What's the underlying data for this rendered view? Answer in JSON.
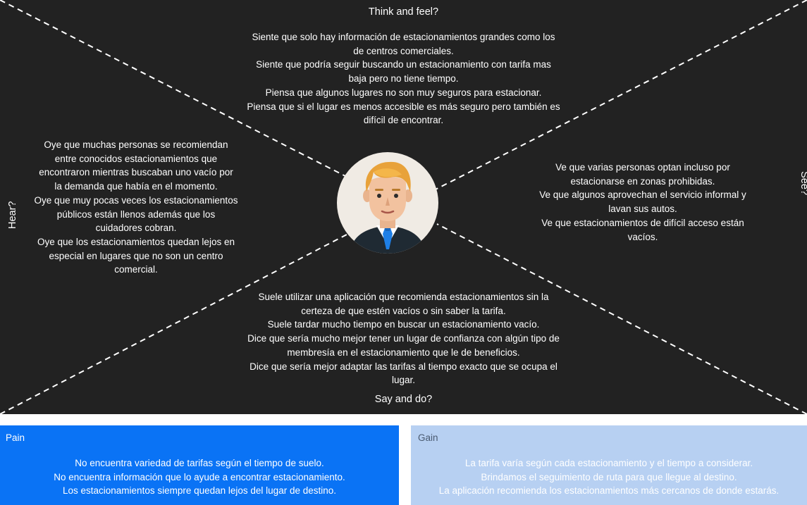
{
  "empathy_map": {
    "think_feel": {
      "title": "Think and feel?",
      "lines": [
        "Siente que solo hay información de estacionamientos grandes como los",
        "de centros comerciales.",
        "Siente que podría seguir buscando un estacionamiento con tarifa mas",
        "baja pero no tiene tiempo.",
        "Piensa que algunos lugares no son muy seguros para estacionar.",
        "Piensa que si el lugar es menos accesible es más seguro pero también es",
        "difícil de encontrar."
      ]
    },
    "hear": {
      "title": "Hear?",
      "lines": [
        "Oye que muchas personas se recomiendan",
        "entre conocidos estacionamientos que",
        "encontraron mientras buscaban uno vacío por",
        "la demanda que había en el momento.",
        "Oye que muy pocas veces los estacionamientos",
        "públicos están llenos además que los",
        "cuidadores cobran.",
        "Oye que los estacionamientos quedan lejos en",
        "especial en lugares que no son un centro",
        "comercial."
      ]
    },
    "see": {
      "title": "See?",
      "lines": [
        "Ve que varias personas optan incluso por",
        "estacionarse en zonas prohibidas.",
        "Ve que algunos aprovechan el servicio informal y",
        "lavan sus autos.",
        "Ve que estacionamientos de difícil acceso están",
        "vacíos."
      ]
    },
    "say_do": {
      "title": "Say and do?",
      "lines": [
        "Suele utilizar una aplicación que recomienda estacionamientos sin la",
        "certeza de que estén vacíos o sin saber la tarifa.",
        "Suele tardar mucho tiempo en buscar un estacionamiento vacío.",
        "Dice que sería  mucho mejor tener un lugar de confianza con algún tipo de",
        "membresía en el estacionamiento que le de beneficios.",
        "Dice que sería mejor adaptar las tarifas al tiempo exacto que se ocupa el",
        "lugar."
      ]
    },
    "center_icon": "user-avatar-icon"
  },
  "pain": {
    "label": "Pain",
    "lines": [
      "No encuentra variedad de tarifas según el tiempo de suelo.",
      "No encuentra información que lo ayude a encontrar estacionamiento.",
      "Los estacionamientos siempre quedan lejos del lugar de destino."
    ]
  },
  "gain": {
    "label": "Gain",
    "lines": [
      "La tarifa varía según cada estacionamiento y el tiempo a considerar.",
      "Brindamos el seguimiento de ruta para que llegue al destino.",
      "La aplicación recomienda los estacionamientos más cercanos de donde estarás."
    ]
  },
  "colors": {
    "map_background": "#222222",
    "pain_background": "#0a73f5",
    "gain_background": "#b7d0f2"
  }
}
